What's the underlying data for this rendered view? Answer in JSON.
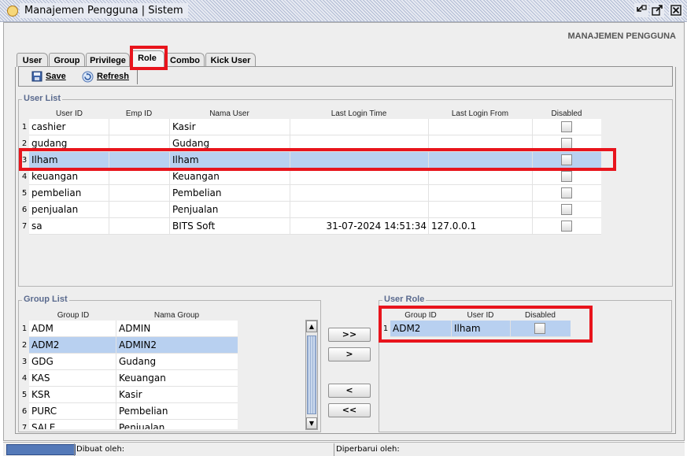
{
  "window": {
    "title": "Manajemen Pengguna | Sistem",
    "controls": [
      "minimize-icon",
      "maximize-icon",
      "close-icon"
    ]
  },
  "header": {
    "title": "MANAJEMEN PENGGUNA"
  },
  "tabs": [
    {
      "label": "User",
      "active": false
    },
    {
      "label": "Group",
      "active": false
    },
    {
      "label": "Privilege",
      "active": false
    },
    {
      "label": "Role",
      "active": true
    },
    {
      "label": "Combo",
      "active": false
    },
    {
      "label": "Kick User",
      "active": false
    }
  ],
  "toolbar": {
    "save_label": "Save",
    "refresh_label": "Refresh",
    "save_icon": "floppy-disk-icon",
    "refresh_icon": "refresh-icon"
  },
  "user_list": {
    "title": "User List",
    "columns": [
      "User ID",
      "Emp ID",
      "Nama User",
      "Last Login Time",
      "Last Login From",
      "Disabled"
    ],
    "rows": [
      {
        "n": "1",
        "user_id": "cashier",
        "emp_id": "",
        "nama": "Kasir",
        "login_time": "",
        "login_from": "",
        "disabled": false
      },
      {
        "n": "2",
        "user_id": "gudang",
        "emp_id": "",
        "nama": "Gudang",
        "login_time": "",
        "login_from": "",
        "disabled": false
      },
      {
        "n": "3",
        "user_id": "Ilham",
        "emp_id": "",
        "nama": "Ilham",
        "login_time": "",
        "login_from": "",
        "disabled": false,
        "selected": true
      },
      {
        "n": "4",
        "user_id": "keuangan",
        "emp_id": "",
        "nama": "Keuangan",
        "login_time": "",
        "login_from": "",
        "disabled": false
      },
      {
        "n": "5",
        "user_id": "pembelian",
        "emp_id": "",
        "nama": "Pembelian",
        "login_time": "",
        "login_from": "",
        "disabled": false
      },
      {
        "n": "6",
        "user_id": "penjualan",
        "emp_id": "",
        "nama": "Penjualan",
        "login_time": "",
        "login_from": "",
        "disabled": false
      },
      {
        "n": "7",
        "user_id": "sa",
        "emp_id": "",
        "nama": "BITS Soft",
        "login_time": "31-07-2024 14:51:34",
        "login_from": "127.0.0.1",
        "disabled": false
      }
    ]
  },
  "group_list": {
    "title": "Group List",
    "columns": [
      "Group ID",
      "Nama Group"
    ],
    "rows": [
      {
        "n": "1",
        "group_id": "ADM",
        "nama": "ADMIN"
      },
      {
        "n": "2",
        "group_id": "ADM2",
        "nama": "ADMIN2",
        "selected": true
      },
      {
        "n": "3",
        "group_id": "GDG",
        "nama": "Gudang"
      },
      {
        "n": "4",
        "group_id": "KAS",
        "nama": "Keuangan"
      },
      {
        "n": "5",
        "group_id": "KSR",
        "nama": "Kasir"
      },
      {
        "n": "6",
        "group_id": "PURC",
        "nama": "Pembelian"
      },
      {
        "n": "7",
        "group_id": "SALE",
        "nama": "Penjualan"
      }
    ]
  },
  "transfer_buttons": [
    ">>",
    ">",
    "<",
    "<<"
  ],
  "user_role": {
    "title": "User Role",
    "columns": [
      "Group ID",
      "User ID",
      "Disabled"
    ],
    "rows": [
      {
        "n": "1",
        "group_id": "ADM2",
        "user_id": "Ilham",
        "disabled": false,
        "selected": true
      }
    ]
  },
  "status": {
    "created_by_label": "Dibuat oleh:",
    "updated_by_label": "Diperbarui oleh:"
  },
  "colors": {
    "highlight": "#e8141c",
    "selection": "#b8d0f0",
    "group_title": "#5a6a8e"
  }
}
